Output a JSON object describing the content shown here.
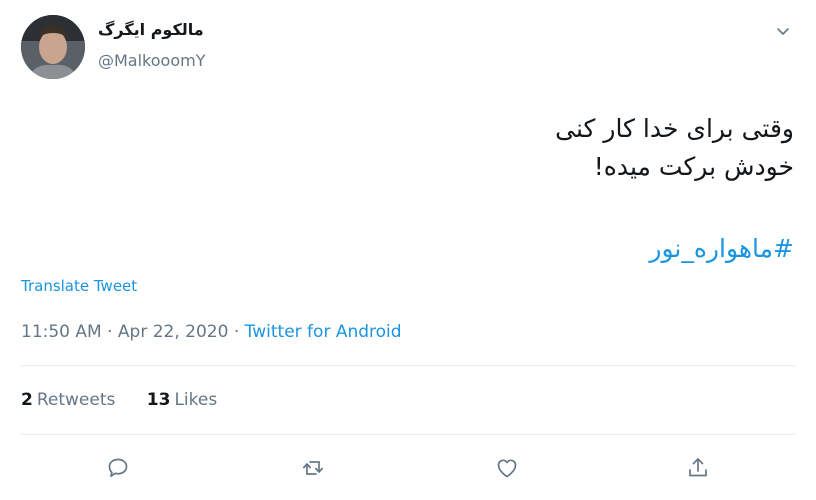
{
  "user": {
    "display_name": "مالکوم ایگرگ",
    "handle": "@MalkooomY"
  },
  "tweet": {
    "lines": [
      "وقتی برای خدا کار کنی",
      "خودش برکت میده!"
    ],
    "hashtag": "#ماهواره_نور",
    "translate_label": "Translate Tweet"
  },
  "meta": {
    "time": "11:50 AM",
    "separator1": " · ",
    "date": "Apr 22, 2020",
    "separator2": " · ",
    "source": "Twitter for Android"
  },
  "stats": {
    "retweets_count": "2",
    "retweets_label": "Retweets",
    "likes_count": "13",
    "likes_label": "Likes"
  },
  "icons": {
    "caret": "chevron-down-icon",
    "reply": "reply-icon",
    "retweet": "retweet-icon",
    "like": "heart-icon",
    "share": "share-icon"
  },
  "colors": {
    "link": "#1b95e0",
    "secondary": "#657786",
    "text": "#14171a",
    "divider": "#e6ecf0"
  }
}
